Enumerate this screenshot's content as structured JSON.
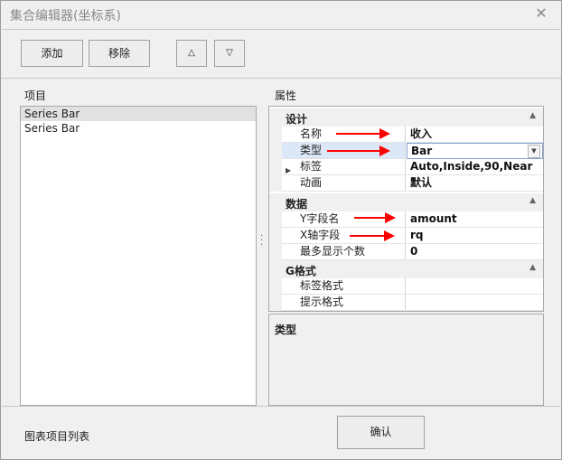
{
  "window": {
    "title": "集合编辑器(坐标系)"
  },
  "toolbar": {
    "add_label": "添加",
    "remove_label": "移除",
    "up_glyph": "△",
    "down_glyph": "▽"
  },
  "left": {
    "header": "项目",
    "items": [
      "Series Bar",
      "Series Bar"
    ],
    "footer": "图表项目列表"
  },
  "right": {
    "header": "属性"
  },
  "propgrid": {
    "categories": [
      {
        "name": "设计",
        "rows": [
          {
            "name": "名称",
            "value": "收入"
          },
          {
            "name": "类型",
            "value": "Bar"
          },
          {
            "name": "标签",
            "value": "Auto,Inside,90,Near"
          },
          {
            "name": "动画",
            "value": "默认"
          }
        ]
      },
      {
        "name": "数据",
        "rows": [
          {
            "name": "Y字段名",
            "value": "amount"
          },
          {
            "name": "X轴字段",
            "value": "rq"
          },
          {
            "name": "最多显示个数",
            "value": "0"
          }
        ]
      },
      {
        "name": "G格式",
        "rows": [
          {
            "name": "标签格式",
            "value": ""
          },
          {
            "name": "提示格式",
            "value": ""
          }
        ]
      }
    ],
    "description_title": "类型"
  },
  "confirm_label": "确认",
  "icons": {
    "close": "close-icon",
    "collapse": "collapse-icon",
    "expand": "expand-icon",
    "dropdown": "dropdown-icon",
    "splitter": "splitter-grip-icon"
  },
  "colors": {
    "annotation_arrow": "#ff0000",
    "selected_row": "#dce8f8"
  }
}
